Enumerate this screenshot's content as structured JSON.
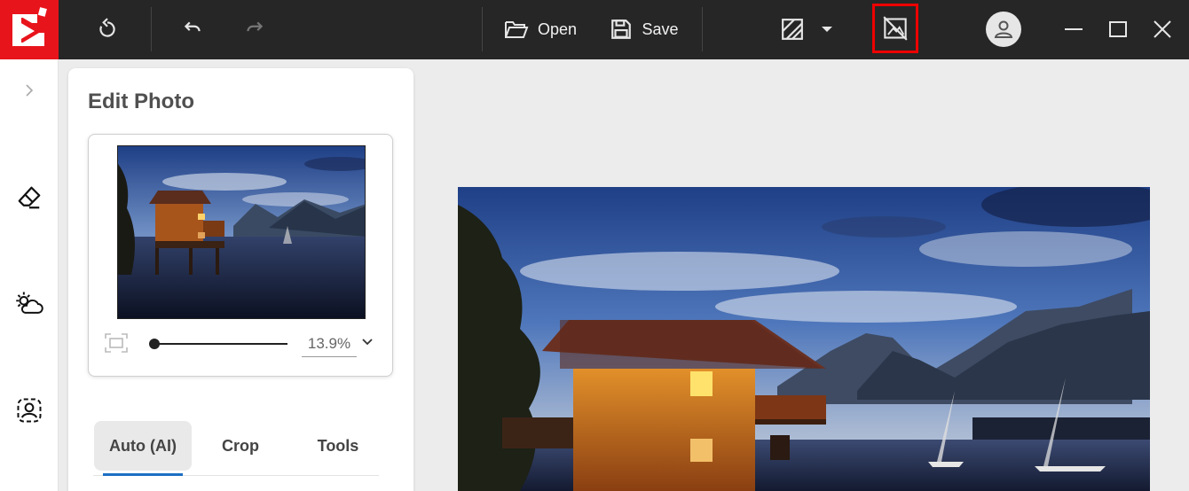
{
  "toolbar": {
    "open_label": "Open",
    "save_label": "Save"
  },
  "panel": {
    "title": "Edit Photo",
    "zoom": "13.9%",
    "tabs": [
      {
        "label": "Auto (AI)",
        "active": true
      },
      {
        "label": "Crop",
        "active": false
      },
      {
        "label": "Tools",
        "active": false
      }
    ]
  },
  "colors": {
    "brand": "#e8141c",
    "topbar": "#262626",
    "highlight": "#e00000",
    "accent": "#1c6fc2"
  }
}
